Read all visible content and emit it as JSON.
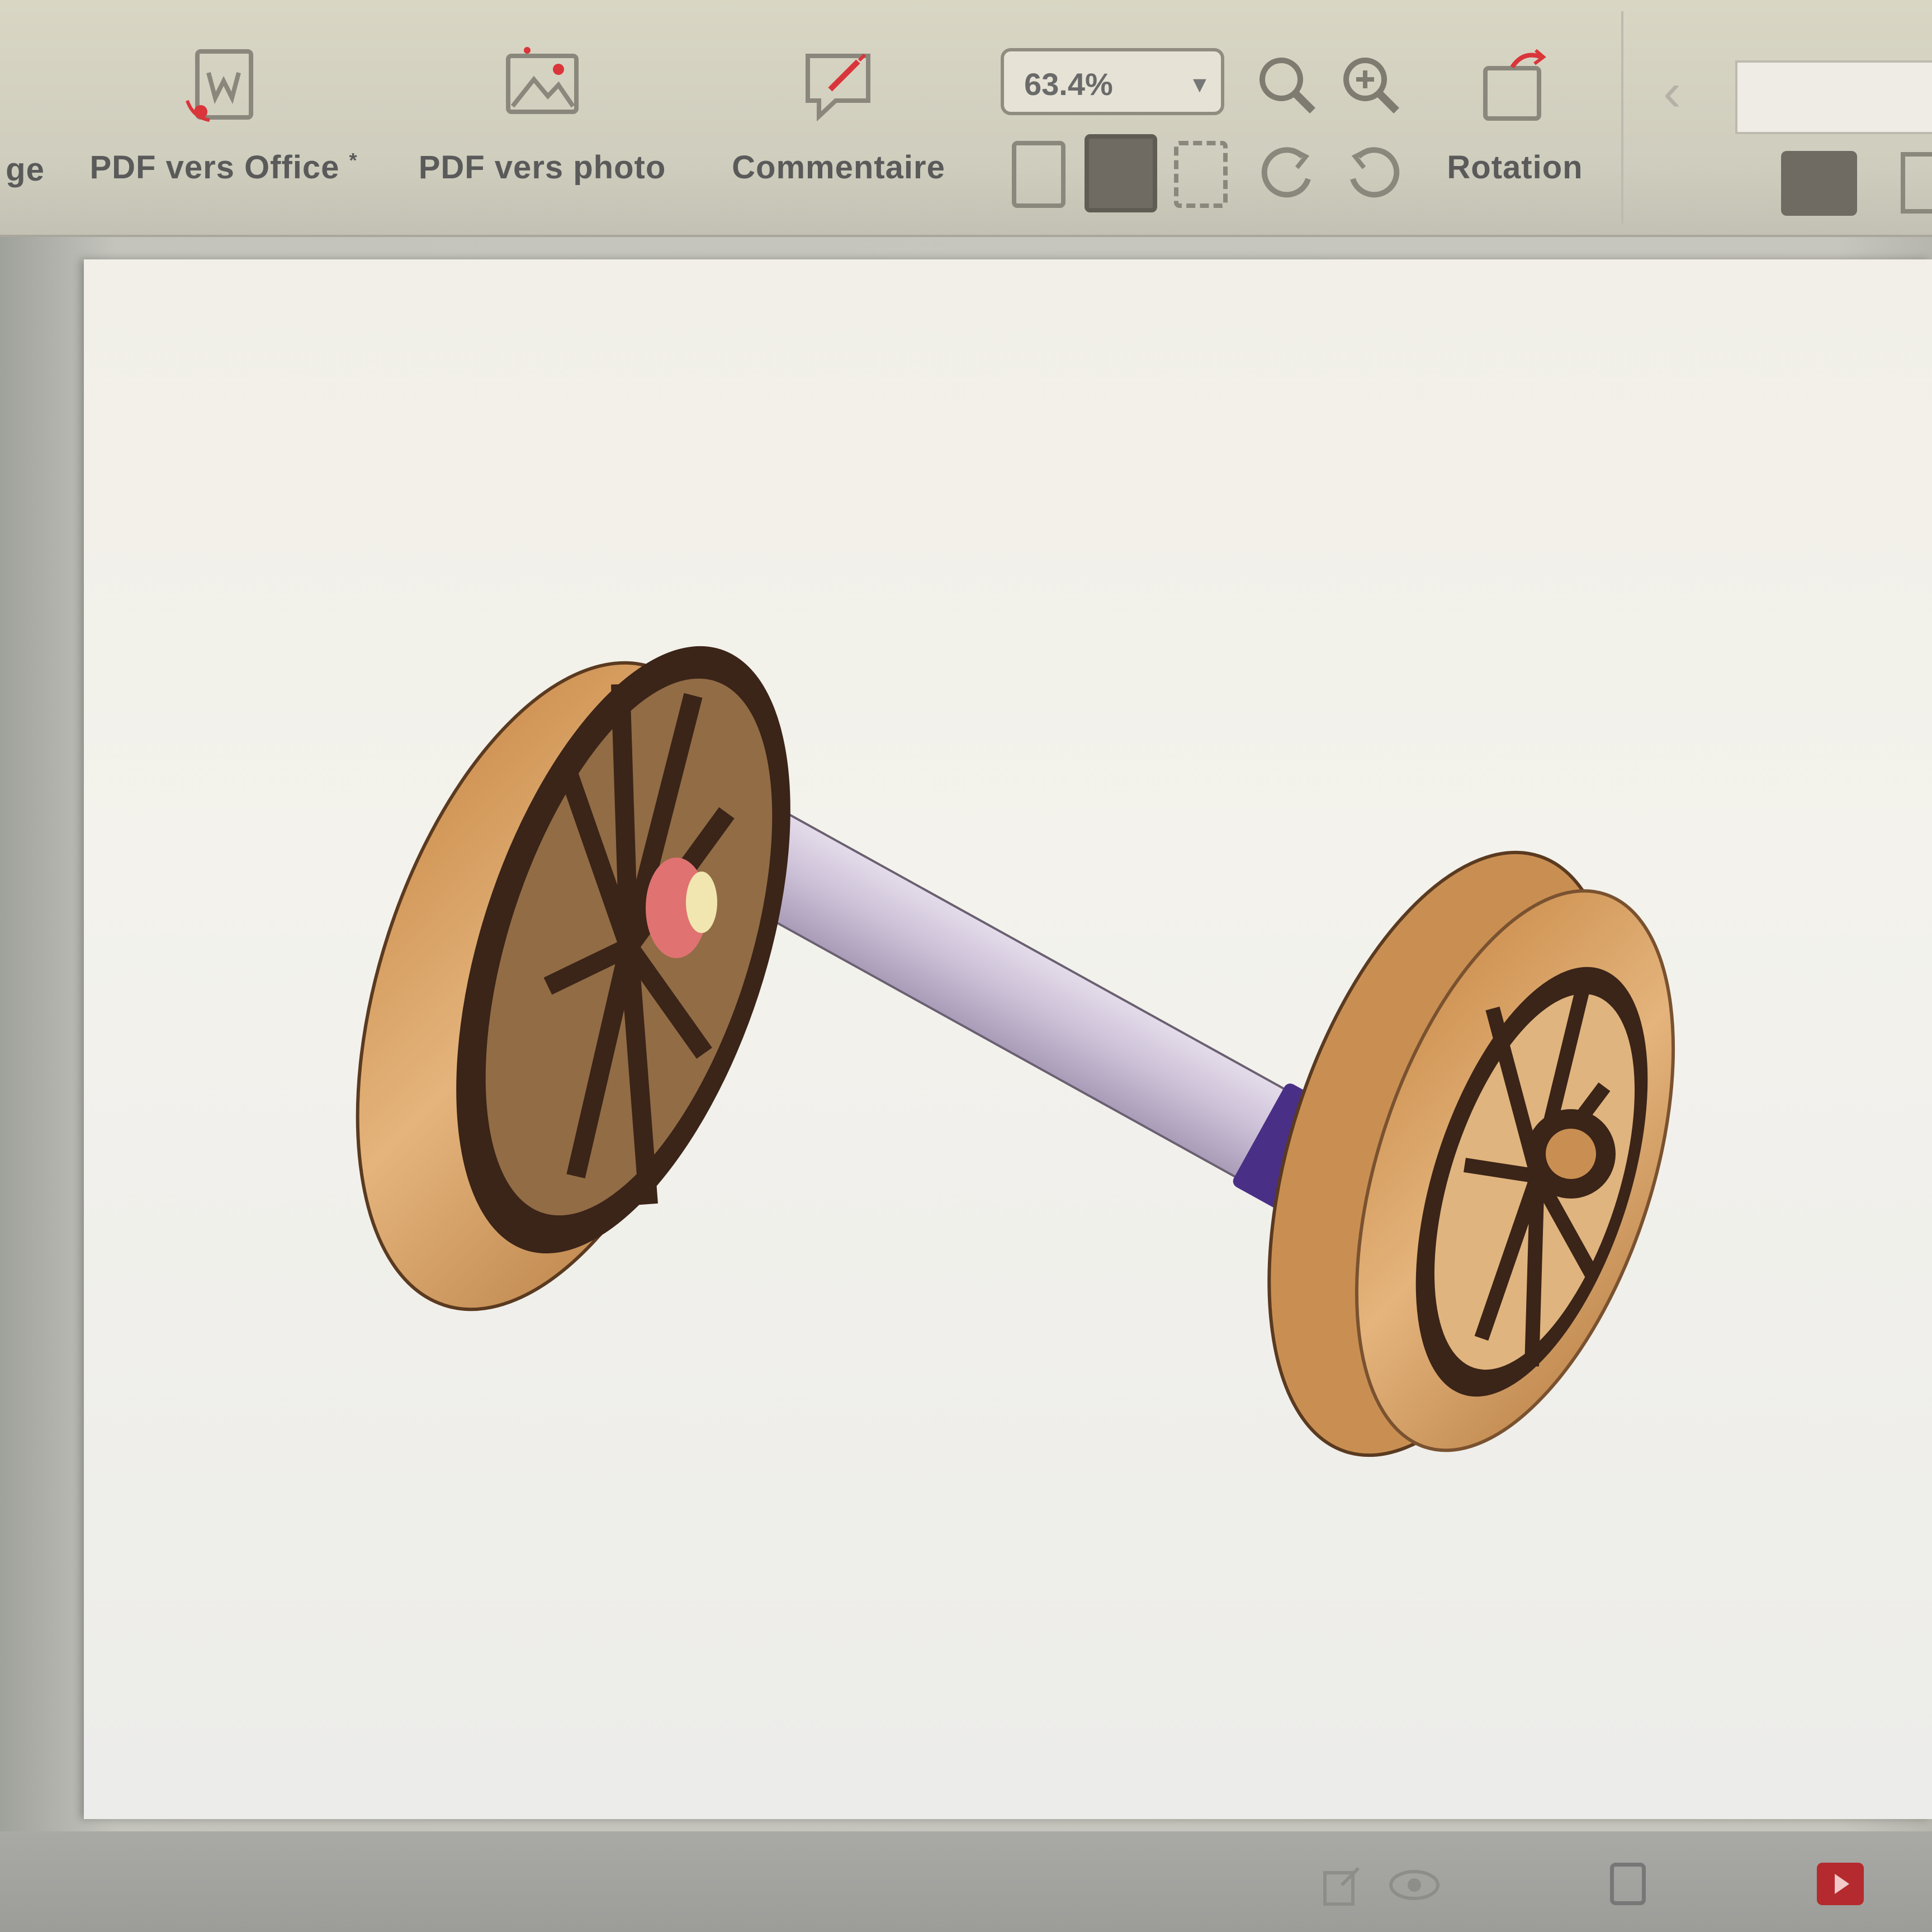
{
  "toolbar": {
    "truncated_left_label": "ge",
    "pdf_to_office_label": "PDF vers Office",
    "pdf_to_office_marker": "*",
    "pdf_to_photo_label": "PDF vers photo",
    "comment_label": "Commentaire",
    "zoom_value": "63.4%",
    "rotation_label": "Rotation"
  },
  "colors": {
    "wheel_tan": "#d9a86c",
    "wheel_dark": "#3b2418",
    "axle": "#d8cfe0",
    "axle_sleeve": "#4a2f86",
    "accent_red": "#d9353a"
  },
  "icons": [
    "pdf-to-office-icon",
    "pdf-to-photo-icon",
    "comment-icon",
    "zoom-dropdown-icon",
    "zoom-out-icon",
    "zoom-in-icon",
    "fit-width-icon",
    "fit-page-icon",
    "actual-size-icon",
    "rotate-left-icon",
    "rotate-right-icon",
    "rotation-icon",
    "back-arrow-icon",
    "view-mode-icon",
    "export-icon",
    "eye-icon",
    "page-icon",
    "record-icon"
  ]
}
